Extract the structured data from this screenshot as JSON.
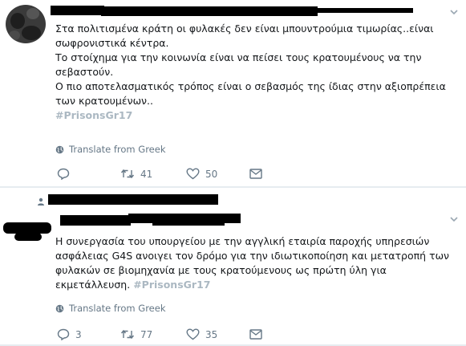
{
  "tweet1": {
    "lines": [
      "Στα πολιτισμένα κράτη οι φυλακές δεν είναι μπουντρούμια τιμωρίας..είναι",
      "σωφρονιστικά κέντρα.",
      "Το στοίχημα για την κοινωνία είναι να πείσει τους κρατουμένους να την",
      "σεβαστούν.",
      "Ο πιο αποτελασματικός τρόπος είναι ο σεβασμός της ίδιας στην αξιοπρέπεια",
      "των κρατουμένων.."
    ],
    "hashtag": "#PrisonsGr17",
    "translate_label": "Translate from Greek",
    "replies": "",
    "retweets": "41",
    "likes": "50"
  },
  "tweet2": {
    "lines": [
      "Η συνεργασία του υπουργείου με την αγγλική εταιρία παροχής υπηρεσιών",
      "ασφάλειας G4S ανοιγει τον δρόμο για την ιδιωτικοποίηση και μετατροπή των",
      "φυλακών σε βιομηχανία με τους κρατούμενους ως πρώτη ύλη για"
    ],
    "last_line_text": "εκμετάλλευση.",
    "hashtag": "#PrisonsGr17",
    "translate_label": "Translate from Greek",
    "replies": "3",
    "retweets": "77",
    "likes": "35"
  },
  "colors": {
    "text": "#14171a",
    "muted": "#657786",
    "hashtag": "#abb8c2",
    "divider": "#e6ecf0"
  },
  "icons": [
    "chevron-down-icon",
    "globe-icon",
    "reply-icon",
    "retweet-icon",
    "like-icon",
    "message-icon",
    "user-icon"
  ]
}
